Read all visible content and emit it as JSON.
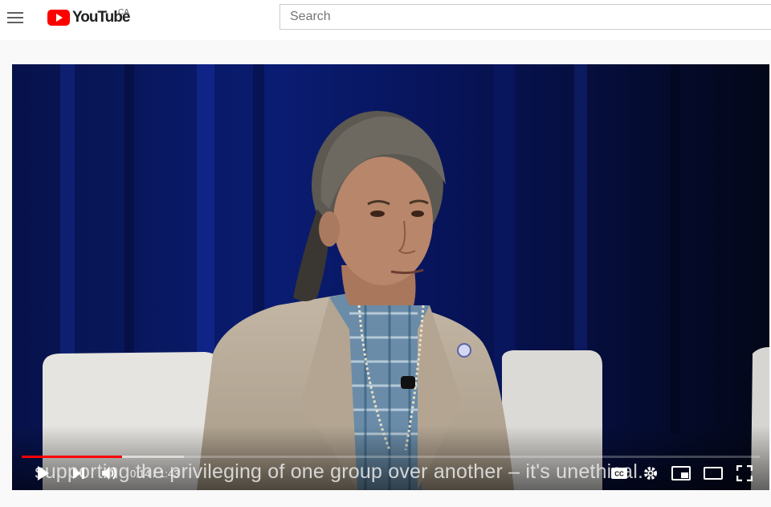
{
  "header": {
    "logo_text": "YouTube",
    "region": "CA",
    "search_placeholder": "Search"
  },
  "player": {
    "current_time": "0:14",
    "duration": "1:43",
    "time_separator": " / ",
    "progress_fraction": 0.136,
    "caption": "supporting the privileging of one group over another – it's unethical.",
    "cc_label": "CC"
  },
  "colors": {
    "accent": "#ff0000"
  }
}
